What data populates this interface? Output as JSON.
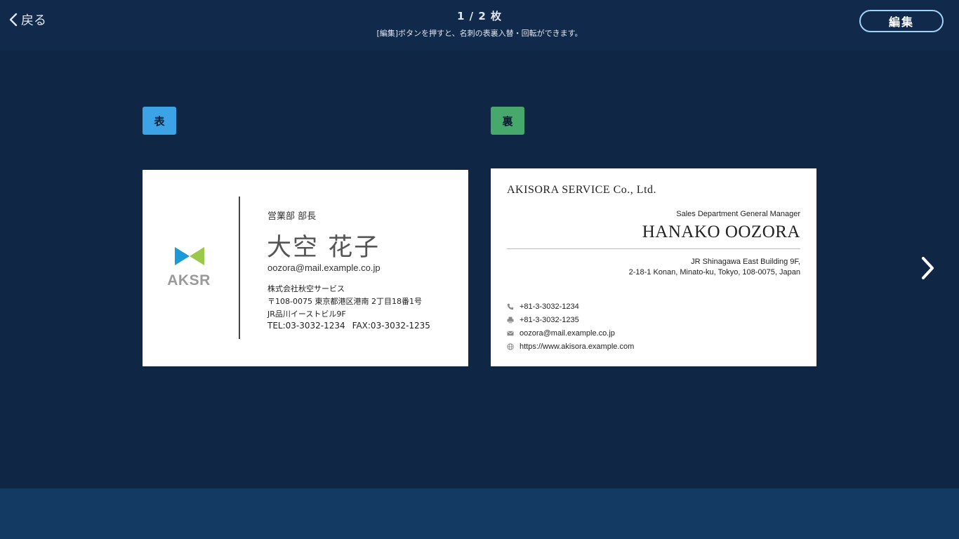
{
  "header": {
    "back_label": "戻る",
    "page_count": "1 / 2 枚",
    "hint": "[編集]ボタンを押すと、名刺の表裏入替・回転ができます。",
    "edit_label": "編集"
  },
  "badges": {
    "front": "表",
    "back": "裏"
  },
  "front_card": {
    "logo_text": "AKSR",
    "title": "営業部 部長",
    "name": "大空 花子",
    "email": "oozora@mail.example.co.jp",
    "company": "株式会社秋空サービス",
    "address_line1": "〒108-0075 東京都港区港南 2丁目18番1号",
    "address_line2": "JR品川イーストビル9F",
    "tel": "TEL:03-3032-1234",
    "fax": "FAX:03-3032-1235"
  },
  "back_card": {
    "company": "AKISORA SERVICE Co., Ltd.",
    "title": "Sales Department General Manager",
    "name": "HANAKO OOZORA",
    "address_line1": "JR Shinagawa East Building 9F,",
    "address_line2": "2-18-1 Konan, Minato-ku, Tokyo, 108-0075, Japan",
    "phone": "+81-3-3032-1234",
    "fax": "+81-3-3032-1235",
    "email": "oozora@mail.example.co.jp",
    "web": "https://www.akisora.example.com"
  },
  "icons": {
    "back": "chevron-left-icon",
    "next": "chevron-right-icon",
    "phone": "phone-icon",
    "fax": "fax-icon",
    "email": "mail-icon",
    "web": "globe-icon"
  },
  "colors": {
    "background": "#0f2744",
    "header": "#11294a",
    "footer": "#133a63",
    "badge_front": "#3ba3e6",
    "badge_back": "#46a86a",
    "edit_border": "#9fd4f5",
    "logo_blue": "#1a9ad6",
    "logo_green": "#9ac94a"
  }
}
